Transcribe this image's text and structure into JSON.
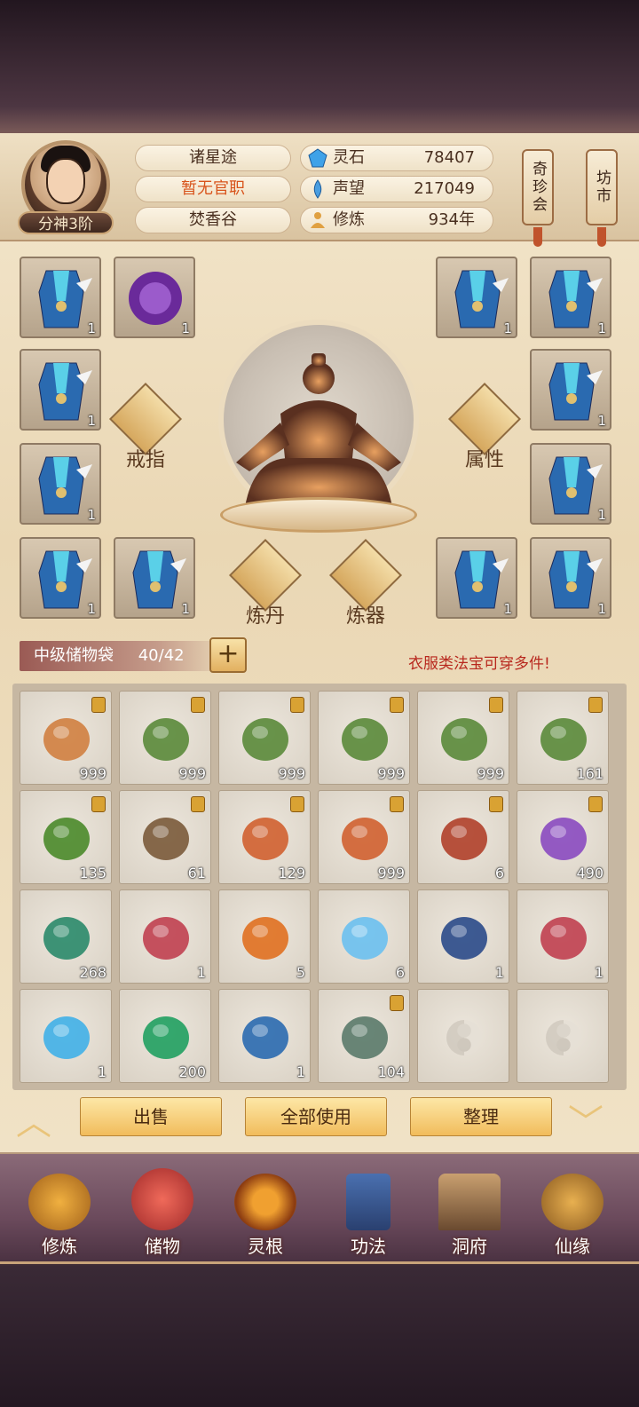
{
  "header": {
    "rank_badge": "分神3阶",
    "name": "诸星途",
    "position": "暂无官职",
    "sect": "焚香谷",
    "resources": [
      {
        "icon": "spirit-stone-icon",
        "label": "灵石",
        "value": "78407"
      },
      {
        "icon": "reputation-icon",
        "label": "声望",
        "value": "217049"
      },
      {
        "icon": "cultivation-icon",
        "label": "修炼",
        "value": "934年"
      }
    ],
    "side_tags": [
      "奇珍会",
      "坊市"
    ]
  },
  "equipment": {
    "actions": [
      "戒指",
      "属性",
      "炼丹",
      "炼器"
    ],
    "slot_qty": "1"
  },
  "bag": {
    "name": "中级储物袋",
    "capacity": "40/42",
    "plus_label": "+",
    "hint": "衣服类法宝可穿多件!"
  },
  "inventory": [
    {
      "item": "ginseng-root",
      "qty": "999",
      "locked": true
    },
    {
      "item": "leaf-seed",
      "qty": "999",
      "locked": true
    },
    {
      "item": "leaf-seed",
      "qty": "999",
      "locked": true
    },
    {
      "item": "leaf-seed",
      "qty": "999",
      "locked": true
    },
    {
      "item": "leaf-seed",
      "qty": "999",
      "locked": true
    },
    {
      "item": "leaf-seed",
      "qty": "161",
      "locked": true
    },
    {
      "item": "herb-sprig",
      "qty": "135",
      "locked": true
    },
    {
      "item": "berry-branch",
      "qty": "61",
      "locked": true
    },
    {
      "item": "ribbon-worm",
      "qty": "129",
      "locked": true
    },
    {
      "item": "ribbon-worm",
      "qty": "999",
      "locked": true
    },
    {
      "item": "red-crystal",
      "qty": "6",
      "locked": true
    },
    {
      "item": "purple-flower",
      "qty": "490",
      "locked": true
    },
    {
      "item": "green-gourd",
      "qty": "268",
      "locked": false
    },
    {
      "item": "scroll-bundle",
      "qty": "1",
      "locked": false
    },
    {
      "item": "orange-gourd",
      "qty": "5",
      "locked": false
    },
    {
      "item": "tea-bowl",
      "qty": "6",
      "locked": false
    },
    {
      "item": "star-mirror",
      "qty": "1",
      "locked": false
    },
    {
      "item": "scroll-bundle",
      "qty": "1",
      "locked": false
    },
    {
      "item": "blue-crystal",
      "qty": "1",
      "locked": false
    },
    {
      "item": "green-gem",
      "qty": "200",
      "locked": false
    },
    {
      "item": "robe",
      "qty": "1",
      "locked": false
    },
    {
      "item": "jade-ore",
      "qty": "104",
      "locked": true
    },
    {
      "item": "empty",
      "qty": "",
      "locked": false
    },
    {
      "item": "empty",
      "qty": "",
      "locked": false
    }
  ],
  "buttons": {
    "sell": "出售",
    "use_all": "全部使用",
    "sort": "整理"
  },
  "nav": [
    "修炼",
    "储物",
    "灵根",
    "功法",
    "洞府",
    "仙缘"
  ]
}
